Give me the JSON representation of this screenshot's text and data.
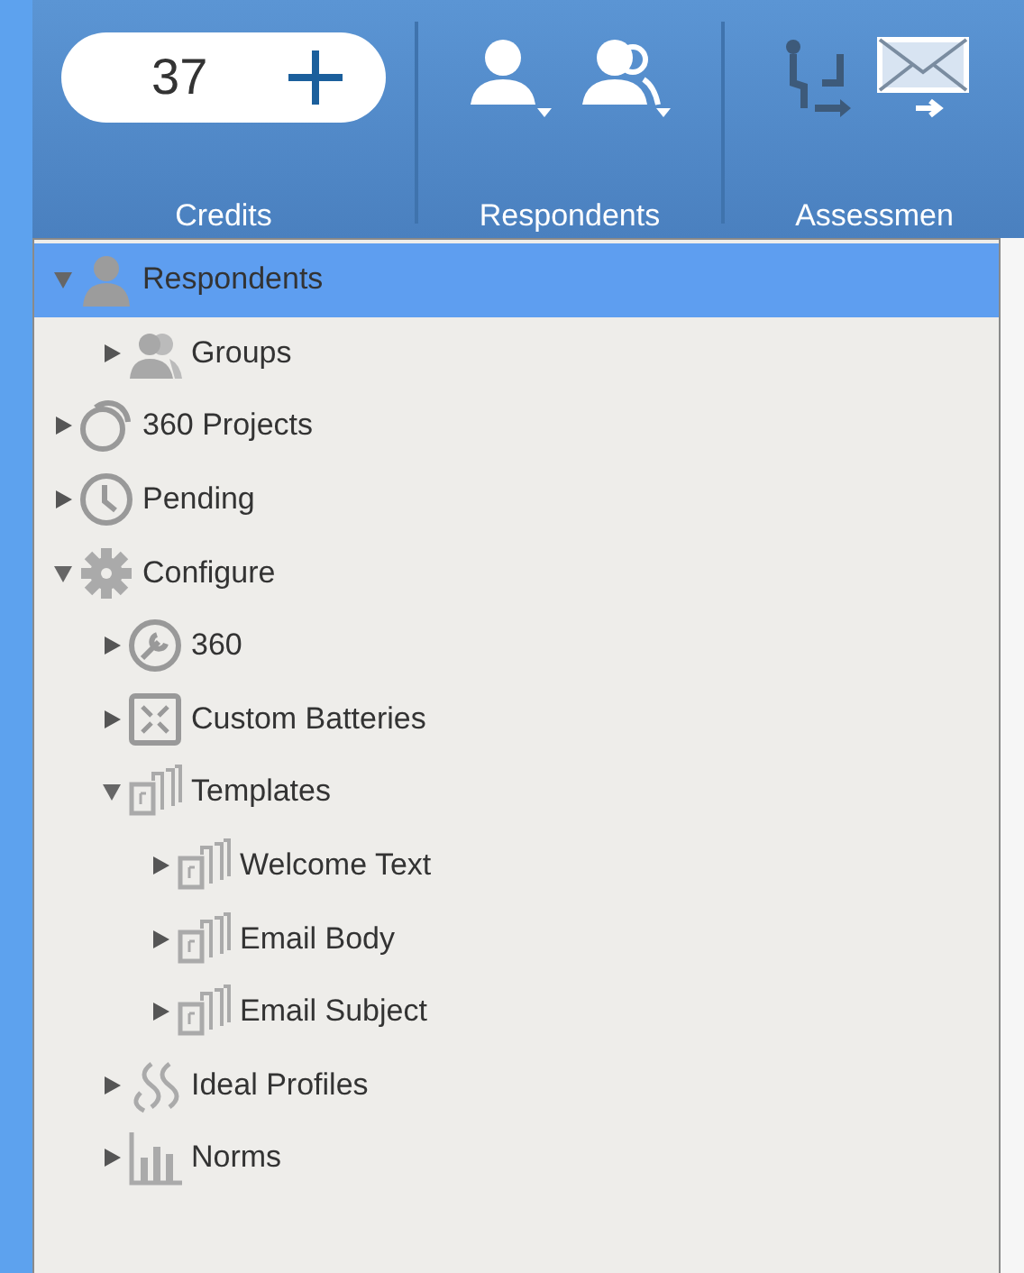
{
  "toolbar": {
    "groups": [
      {
        "kind": "credits",
        "label": "Credits",
        "value": "37"
      },
      {
        "kind": "respondents",
        "label": "Respondents"
      },
      {
        "kind": "assessments",
        "label": "Assessmen"
      }
    ]
  },
  "tree": [
    {
      "label": "Respondents",
      "kind": "person",
      "expanded": true,
      "selected": true,
      "children": [
        {
          "label": "Groups",
          "kind": "group",
          "expanded": false,
          "selected": false
        }
      ]
    },
    {
      "label": "360 Projects",
      "kind": "rings",
      "expanded": false,
      "selected": false
    },
    {
      "label": "Pending",
      "kind": "clock",
      "expanded": false,
      "selected": false
    },
    {
      "label": "Configure",
      "kind": "gear",
      "expanded": true,
      "selected": false,
      "children": [
        {
          "label": "360",
          "kind": "wrench",
          "expanded": false,
          "selected": false
        },
        {
          "label": "Custom Batteries",
          "kind": "battery",
          "expanded": false,
          "selected": false
        },
        {
          "label": "Templates",
          "kind": "template",
          "expanded": true,
          "selected": false,
          "children": [
            {
              "label": "Welcome Text",
              "kind": "template",
              "expanded": false,
              "selected": false
            },
            {
              "label": "Email Body",
              "kind": "template",
              "expanded": false,
              "selected": false
            },
            {
              "label": "Email Subject",
              "kind": "template",
              "expanded": false,
              "selected": false
            }
          ]
        },
        {
          "label": "Ideal Profiles",
          "kind": "wave",
          "expanded": false,
          "selected": false
        },
        {
          "label": "Norms",
          "kind": "bars",
          "expanded": false,
          "selected": false
        }
      ]
    }
  ]
}
